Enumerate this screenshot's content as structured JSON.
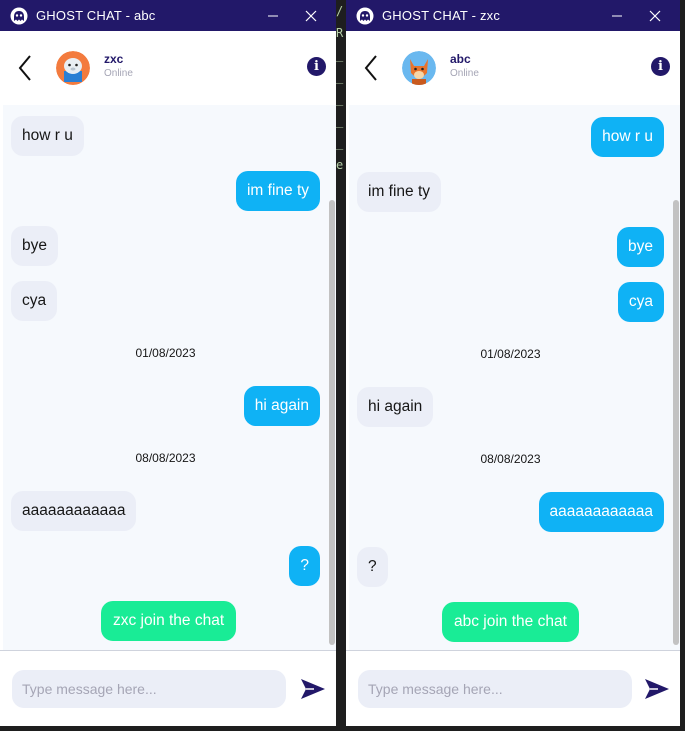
{
  "windows": [
    {
      "title": "GHOST CHAT - abc",
      "contact": {
        "name": "zxc",
        "status": "Online"
      },
      "messages": [
        {
          "text": "how r u"
        },
        {
          "text": "im fine ty"
        },
        {
          "text": "bye"
        },
        {
          "text": "cya"
        },
        {
          "date": "01/08/2023"
        },
        {
          "text": "hi again"
        },
        {
          "date": "08/08/2023"
        },
        {
          "text": "aaaaaaaaaaaa"
        },
        {
          "text": "?"
        },
        {
          "text": "zxc join the chat"
        }
      ],
      "input": {
        "placeholder": "Type message here..."
      }
    },
    {
      "title": "GHOST CHAT - zxc",
      "contact": {
        "name": "abc",
        "status": "Online"
      },
      "messages": [
        {
          "text": "how r u"
        },
        {
          "text": "im fine ty"
        },
        {
          "text": "bye"
        },
        {
          "text": "cya"
        },
        {
          "date": "01/08/2023"
        },
        {
          "text": "hi again"
        },
        {
          "date": "08/08/2023"
        },
        {
          "text": "aaaaaaaaaaaa"
        },
        {
          "text": "?"
        },
        {
          "text": "abc join the chat"
        }
      ],
      "input": {
        "placeholder": "Type message here..."
      }
    }
  ],
  "colors": {
    "titlebar": "#221869",
    "outgoing_bubble": "#0fb2f5",
    "incoming_bubble": "#ebeef7",
    "join_bubble": "#19ec96",
    "chat_background": "#f6f9fd"
  },
  "icons": [
    "ghost-icon",
    "minimize-icon",
    "close-icon",
    "back-arrow-icon",
    "info-icon",
    "send-icon"
  ]
}
